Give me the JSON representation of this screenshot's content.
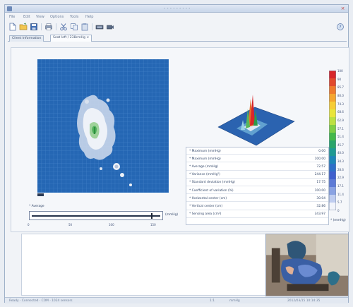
{
  "window": {
    "title": "- - - - - - - - -"
  },
  "menu": [
    "File",
    "Edit",
    "View",
    "Options",
    "Tools",
    "Help"
  ],
  "toolbar": {
    "icons": [
      "new-icon",
      "open-icon",
      "save-icon",
      "print-icon",
      "cut-icon",
      "copy-icon",
      "paste-icon",
      "device-icon",
      "record-icon"
    ]
  },
  "tabs": [
    {
      "label": "Client Information",
      "active": false
    },
    {
      "label": "Seat left / 238cmHg ×",
      "active": true
    }
  ],
  "stats": [
    {
      "label": "* Maximum (mmHg)",
      "value": "0.00"
    },
    {
      "label": "* Maximum (mmHg)",
      "value": "100.00"
    },
    {
      "label": "* Average (mmHg)",
      "value": "72.57"
    },
    {
      "label": "* Variance (mmHg²)",
      "value": "244.17"
    },
    {
      "label": "* Standard deviation (mmHg)",
      "value": "17.75"
    },
    {
      "label": "* Coefficient of variation (%)",
      "value": "100.00"
    },
    {
      "label": "* Horizontal center (cm)",
      "value": "30.04"
    },
    {
      "label": "* Vertical center (cm)",
      "value": "32.86"
    },
    {
      "label": "* Sensing area (cm²)",
      "value": "343.97"
    }
  ],
  "colorbar": {
    "labels": [
      "100",
      "90",
      "85.7",
      "80.0",
      "74.3",
      "68.6",
      "62.9",
      "57.1",
      "51.4",
      "45.7",
      "40.0",
      "34.3",
      "28.6",
      "22.9",
      "17.1",
      "11.4",
      "5.7",
      "0"
    ],
    "colors": [
      "#d8262a",
      "#e24a2c",
      "#ef7b2c",
      "#f5a62f",
      "#f7cd35",
      "#e9e53b",
      "#bce042",
      "#7fce45",
      "#45b84b",
      "#2aa56a",
      "#1f9a93",
      "#1e86b8",
      "#2e6fc8",
      "#3f5fcd",
      "#5c7ad6",
      "#8aa3e3",
      "#bfcdf0",
      "#f1f4fb"
    ],
    "unit": "* (mmHg)"
  },
  "slider": {
    "label": "* Average",
    "unit": "(mmHg)",
    "ticks": [
      "0",
      "50",
      "100",
      "150"
    ],
    "level": 0.92
  },
  "status": {
    "left": "Ready  ·  Connected  ·  COM  ·  1024 sensors",
    "mid1": "1:1",
    "mid2": "mmHg",
    "right": "2012/03/15  10:14:35"
  }
}
